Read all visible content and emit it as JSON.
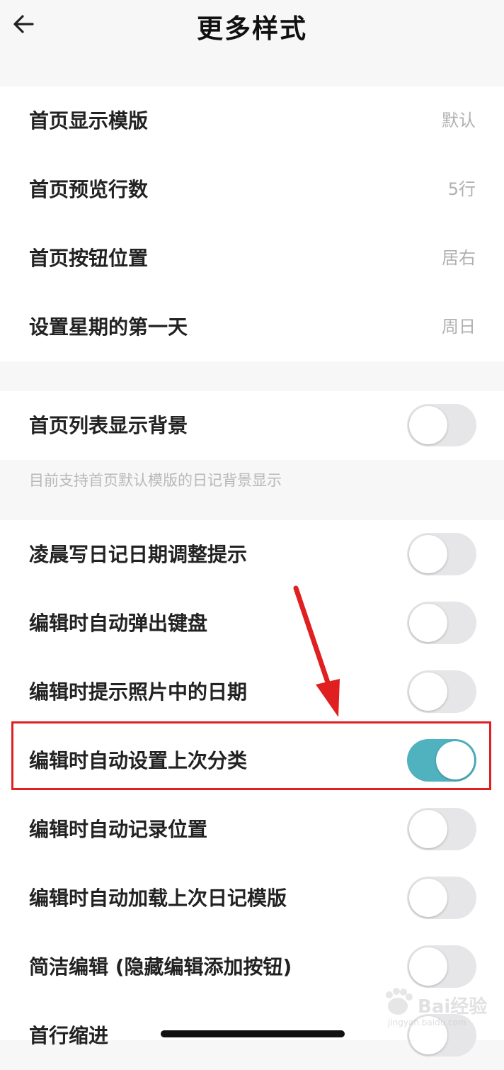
{
  "header": {
    "title": "更多样式"
  },
  "section1": [
    {
      "label": "首页显示模版",
      "value": "默认"
    },
    {
      "label": "首页预览行数",
      "value": "5行"
    },
    {
      "label": "首页按钮位置",
      "value": "居右"
    },
    {
      "label": "设置星期的第一天",
      "value": "周日"
    }
  ],
  "section2": {
    "label": "首页列表显示背景",
    "enabled": false,
    "note": "目前支持首页默认模版的日记背景显示"
  },
  "section3": [
    {
      "label": "凌晨写日记日期调整提示",
      "enabled": false
    },
    {
      "label": "编辑时自动弹出键盘",
      "enabled": false
    },
    {
      "label": "编辑时提示照片中的日期",
      "enabled": false
    },
    {
      "label": "编辑时自动设置上次分类",
      "enabled": true
    },
    {
      "label": "编辑时自动记录位置",
      "enabled": false
    },
    {
      "label": "编辑时自动加载上次日记模版",
      "enabled": false
    },
    {
      "label": "简洁编辑 (隐藏编辑添加按钮)",
      "enabled": false
    },
    {
      "label": "首行缩进",
      "enabled": false
    }
  ],
  "watermark": {
    "text": "Bai经验",
    "sub": "jingyan.baidu.com"
  },
  "colors": {
    "toggle_on": "#4fb2be",
    "toggle_off": "#e6e6e8",
    "highlight": "#e02020"
  },
  "icons": {
    "back": "arrow-left-icon"
  }
}
